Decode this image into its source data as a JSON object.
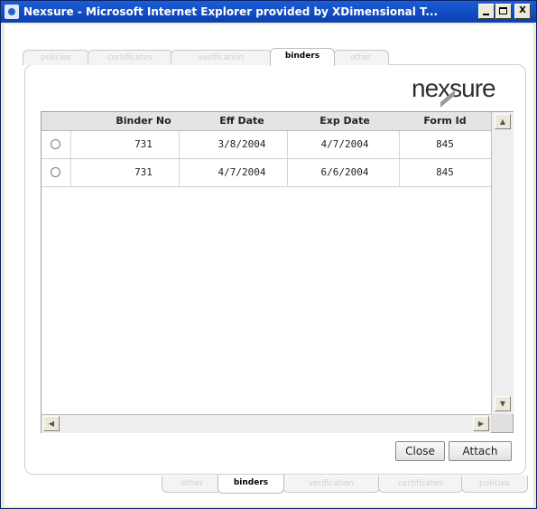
{
  "window": {
    "title": "Nexsure - Microsoft Internet Explorer provided by XDimensional T...",
    "min_label": "_",
    "max_label": "",
    "close_label": "X"
  },
  "tabs_top": [
    {
      "label": "policies",
      "active": false
    },
    {
      "label": "certificates",
      "active": false
    },
    {
      "label": "verification",
      "active": false
    },
    {
      "label": "binders",
      "active": true
    },
    {
      "label": "other",
      "active": false
    }
  ],
  "tabs_bottom": [
    {
      "label": "other",
      "active": false
    },
    {
      "label": "binders",
      "active": true
    },
    {
      "label": "verification",
      "active": false
    },
    {
      "label": "certificates",
      "active": false
    },
    {
      "label": "policies",
      "active": false
    }
  ],
  "logo": {
    "text": "nexsure",
    "accent": "#9a9a9a"
  },
  "grid": {
    "columns": [
      "Binder No",
      "Eff Date",
      "Exp Date",
      "Form Id"
    ],
    "rows": [
      {
        "binder_no": "731",
        "eff_date": "3/8/2004",
        "exp_date": "4/7/2004",
        "form_id": "845"
      },
      {
        "binder_no": "731",
        "eff_date": "4/7/2004",
        "exp_date": "6/6/2004",
        "form_id": "845"
      }
    ]
  },
  "buttons": {
    "close": "Close",
    "attach": "Attach"
  },
  "colors": {
    "titlebar": "#0a3fb0",
    "window_frame": "#ece9d8"
  }
}
